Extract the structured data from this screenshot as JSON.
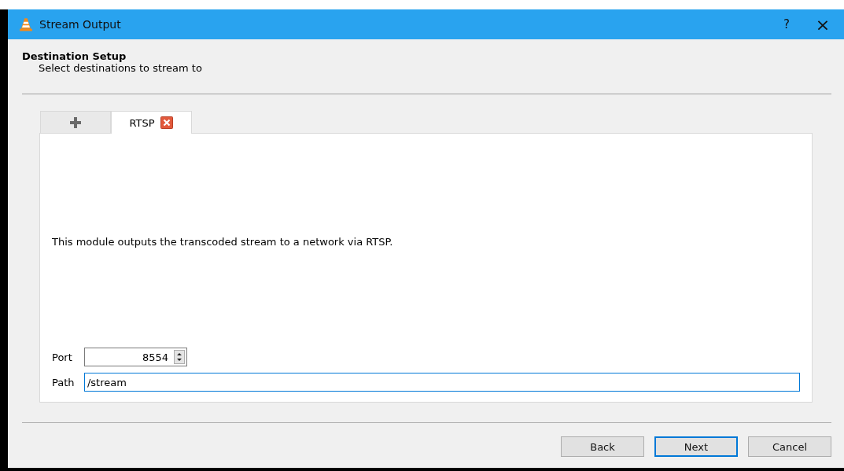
{
  "window": {
    "title": "Stream Output",
    "help": "?",
    "close": "×"
  },
  "header": {
    "title": "Destination Setup",
    "subtitle": "Select destinations to stream to"
  },
  "tabs": [
    {
      "kind": "add",
      "selected": false
    },
    {
      "kind": "module",
      "label": "RTSP",
      "selected": true,
      "closable": true
    }
  ],
  "panel": {
    "description": "This module outputs the transcoded stream to a network via RTSP.",
    "fields": [
      {
        "kind": "spin",
        "label": "Port",
        "value": "8554"
      },
      {
        "kind": "text",
        "label": "Path",
        "value": "/stream",
        "focused": true
      }
    ]
  },
  "buttons": [
    {
      "label": "Back",
      "default": false
    },
    {
      "label": "Next",
      "default": true
    },
    {
      "label": "Cancel",
      "default": false
    }
  ]
}
